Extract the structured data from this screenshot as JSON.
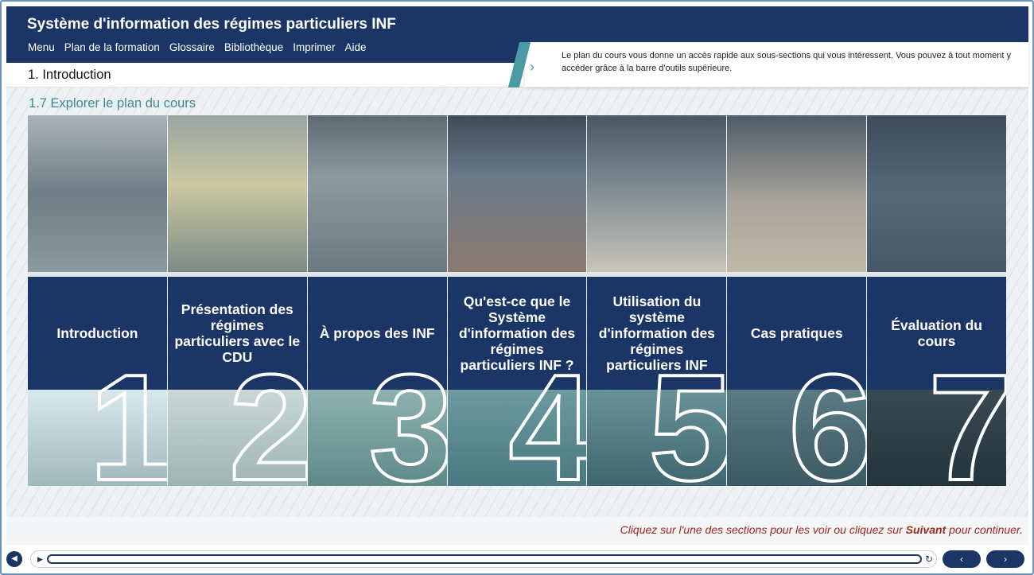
{
  "app": {
    "title": "Système d'information des régimes particuliers INF"
  },
  "nav": [
    "Menu",
    "Plan de la formation",
    "Glossaire",
    "Bibliothèque",
    "Imprimer",
    "Aide"
  ],
  "breadcrumb": "1. Introduction",
  "info_text": "Le plan du cours vous donne un accès rapide aux sous-sections qui vous intéressent. Vous pouvez à tout moment y accéder grâce à la barre d'outils supérieure.",
  "subtitle": "1.7 Explorer le plan du cours",
  "sections": [
    {
      "number": "1",
      "label": "Introduction"
    },
    {
      "number": "2",
      "label": "Présentation des régimes particuliers avec le CDU"
    },
    {
      "number": "3",
      "label": "À propos des INF"
    },
    {
      "number": "4",
      "label": "Qu'est-ce que le Système d'information des régimes particuliers INF ?"
    },
    {
      "number": "5",
      "label": "Utilisation du système d'information des régimes particuliers INF"
    },
    {
      "number": "6",
      "label": "Cas pratiques"
    },
    {
      "number": "7",
      "label": "Évaluation du cours"
    }
  ],
  "hint": {
    "before": "Cliquez sur l'une des sections pour les voir ou cliquez sur ",
    "bold": "Suivant",
    "after": " pour continuer."
  },
  "player": {
    "volume_icon": "speaker-icon",
    "play_icon": "play-icon",
    "replay_icon": "replay-icon",
    "prev": "‹",
    "next": "›",
    "progress": 0
  },
  "colors": {
    "brand": "#1b3567",
    "accent": "#4a9aa3",
    "hint": "#a0281c"
  }
}
